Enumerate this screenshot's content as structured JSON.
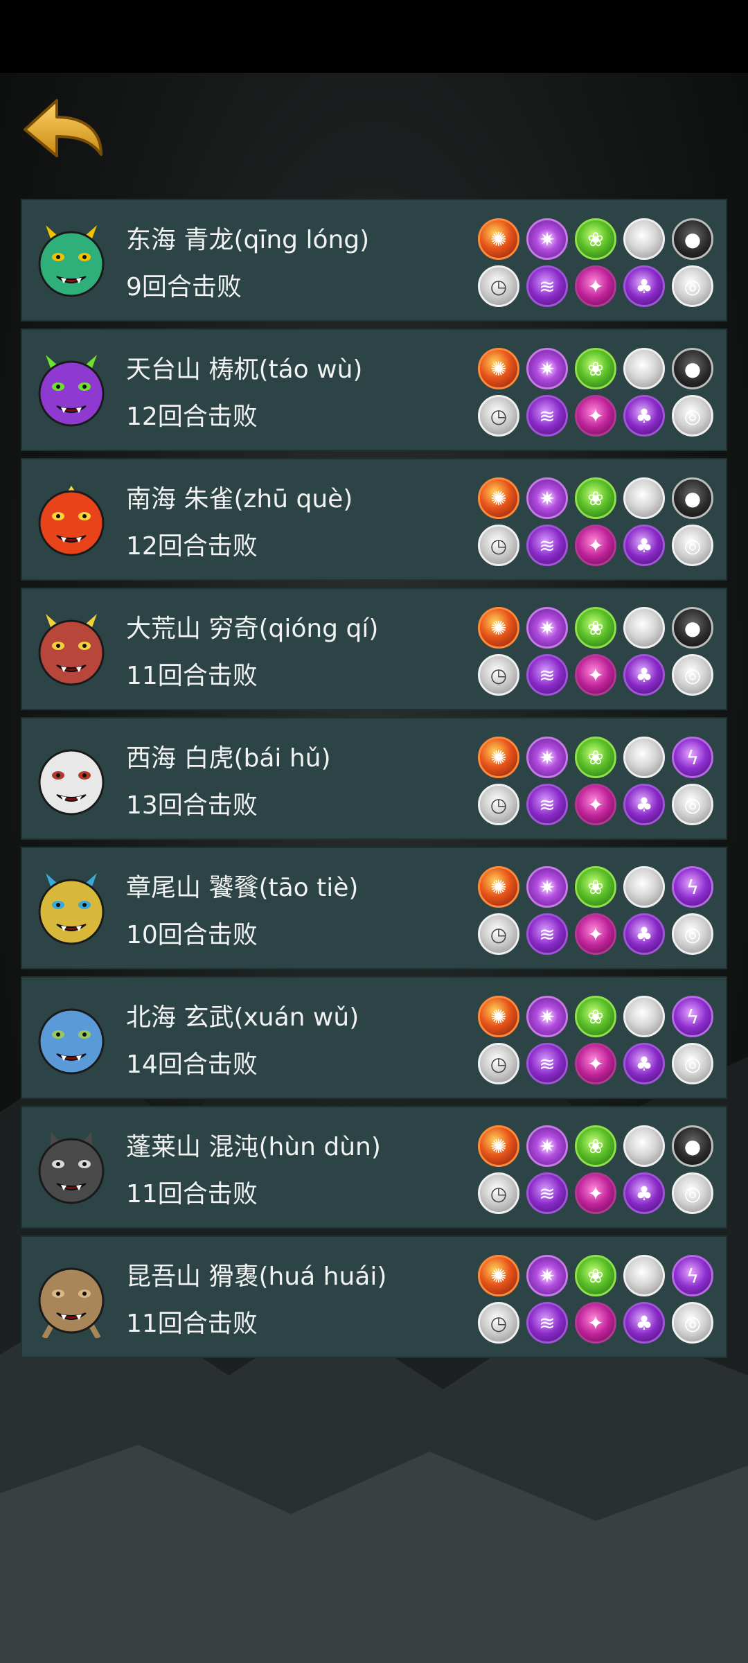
{
  "title": "",
  "bosses": [
    {
      "name": "东海 青龙(qīng lóng)",
      "result": "9回合击败",
      "creature": "dragon",
      "colors": {
        "main": "#2fb07a",
        "accent": "#f2c200"
      },
      "top": [
        "fire",
        "spark",
        "leaf",
        "pearl",
        "dark"
      ],
      "bottom": [
        "clock",
        "wave",
        "pink",
        "tree",
        "swirl"
      ]
    },
    {
      "name": "天台山 梼杌(táo wù)",
      "result": "12回合击败",
      "creature": "beast",
      "colors": {
        "main": "#8e3ad0",
        "accent": "#6fe030"
      },
      "top": [
        "fire",
        "spark",
        "leaf",
        "pearl",
        "dark"
      ],
      "bottom": [
        "clock",
        "wave",
        "pink",
        "tree",
        "swirl"
      ]
    },
    {
      "name": "南海 朱雀(zhū què)",
      "result": "12回合击败",
      "creature": "bird",
      "colors": {
        "main": "#e8431a",
        "accent": "#ffd43a"
      },
      "top": [
        "fire",
        "spark",
        "leaf",
        "pearl",
        "dark"
      ],
      "bottom": [
        "clock",
        "wave",
        "pink",
        "tree",
        "swirl"
      ]
    },
    {
      "name": "大荒山 穷奇(qióng qí)",
      "result": "11回合击败",
      "creature": "beast",
      "colors": {
        "main": "#b8463a",
        "accent": "#f2d23a"
      },
      "top": [
        "fire",
        "spark",
        "leaf",
        "pearl",
        "dark"
      ],
      "bottom": [
        "clock",
        "wave",
        "pink",
        "tree",
        "swirl"
      ]
    },
    {
      "name": "西海 白虎(bái hǔ)",
      "result": "13回合击败",
      "creature": "tiger",
      "colors": {
        "main": "#e8e8e8",
        "accent": "#b33a2a"
      },
      "top": [
        "fire",
        "spark",
        "leaf",
        "pearl",
        "bolt"
      ],
      "bottom": [
        "clock",
        "wave",
        "pink",
        "tree",
        "swirl"
      ]
    },
    {
      "name": "章尾山 饕餮(tāo tiè)",
      "result": "10回合击败",
      "creature": "beast",
      "colors": {
        "main": "#d8b83a",
        "accent": "#3aa8d8"
      },
      "top": [
        "fire",
        "spark",
        "leaf",
        "pearl",
        "bolt"
      ],
      "bottom": [
        "clock",
        "wave",
        "pink",
        "tree",
        "swirl"
      ]
    },
    {
      "name": "北海 玄武(xuán wǔ)",
      "result": "14回合击败",
      "creature": "turtle",
      "colors": {
        "main": "#5a9ad8",
        "accent": "#9ac860"
      },
      "top": [
        "fire",
        "spark",
        "leaf",
        "pearl",
        "bolt"
      ],
      "bottom": [
        "clock",
        "wave",
        "pink",
        "tree",
        "swirl"
      ]
    },
    {
      "name": "蓬莱山 混沌(hùn dùn)",
      "result": "11回合击败",
      "creature": "wolf",
      "colors": {
        "main": "#4a4a4a",
        "accent": "#d8d8d8"
      },
      "top": [
        "fire",
        "spark",
        "leaf",
        "pearl",
        "dark"
      ],
      "bottom": [
        "clock",
        "wave",
        "pink",
        "tree",
        "swirl"
      ]
    },
    {
      "name": "昆吾山 猾褢(huá huái)",
      "result": "11回合击败",
      "creature": "ape",
      "colors": {
        "main": "#a8865a",
        "accent": "#d8b888"
      },
      "top": [
        "fire",
        "spark",
        "leaf",
        "pearl",
        "bolt"
      ],
      "bottom": [
        "clock",
        "wave",
        "pink",
        "tree",
        "swirl"
      ]
    }
  ],
  "orb_icons": {
    "fire": "fire-orb-icon",
    "spark": "spark-orb-icon",
    "leaf": "leaf-orb-icon",
    "pearl": "pearl-orb-icon",
    "dark": "dark-orb-icon",
    "bolt": "lightning-orb-icon",
    "clock": "clock-orb-icon",
    "wave": "wave-orb-icon",
    "pink": "pink-orb-icon",
    "tree": "tree-orb-icon",
    "swirl": "swirl-orb-icon"
  }
}
